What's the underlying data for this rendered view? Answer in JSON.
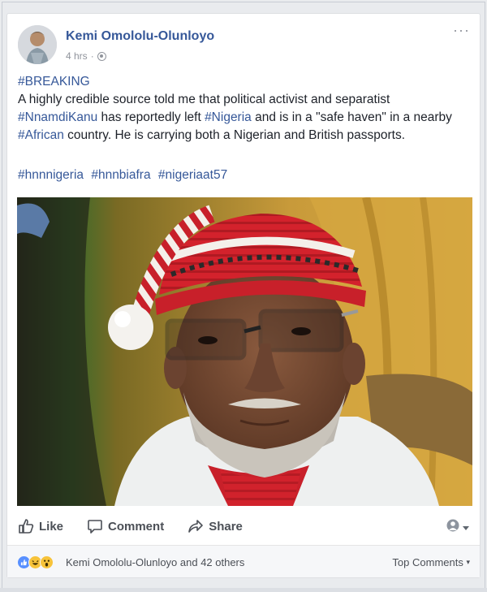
{
  "post": {
    "author": "Kemi Omololu-Olunloyo",
    "time": "4 hrs",
    "time_separator": "·",
    "more_label": "···",
    "heading": "#BREAKING",
    "body_1": "A highly credible source told me that political activist and separatist ",
    "tag_1": "#NnamdiKanu",
    "body_2": " has reportedly left ",
    "tag_2": "#Nigeria",
    "body_3": " and is in a \"safe haven\" in a nearby ",
    "tag_3": "#African",
    "body_4": " country. He is carrying both a Nigerian and British passports.",
    "hashtags": [
      "#hnnnigeria",
      "#hnnbiafra",
      "#nigeriaat57"
    ]
  },
  "actions": {
    "like": "Like",
    "comment": "Comment",
    "share": "Share"
  },
  "footer": {
    "reactors": "Kemi Omololu-Olunloyo and 42 others",
    "sort_label": "Top Comments"
  },
  "colors": {
    "link": "#365899",
    "like_blue": "#5890ff",
    "haha_yellow": "#f7c33a"
  },
  "icons": {
    "like": "thumbs-up-icon",
    "comment": "speech-bubble-icon",
    "share": "share-arrow-icon",
    "privacy": "globe-icon"
  }
}
